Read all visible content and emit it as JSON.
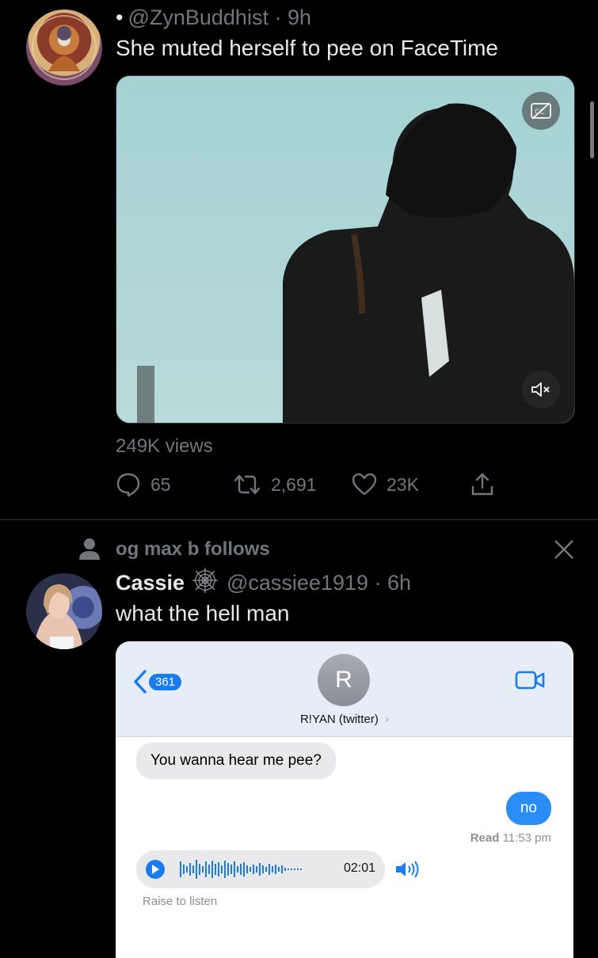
{
  "tweet1": {
    "bullet": "•",
    "handle_time": "@ZynBuddhist · 9h",
    "text": "She muted herself to pee on FaceTime",
    "views": "249K views",
    "replies": "65",
    "retweets": "2,691",
    "likes": "23K"
  },
  "tweet2": {
    "social_context": "og max b follows",
    "name": "Cassie",
    "handle_time": "@cassiee1919 · 6h",
    "text": "what the hell man",
    "imessage": {
      "back_count": "361",
      "contact_initial": "R",
      "contact_name": "R!YAN (twitter)",
      "incoming_message": "You wanna hear me pee?",
      "outgoing_message": "no",
      "read_status": "Read",
      "read_time": "11:53 pm",
      "audio_duration": "02:01",
      "raise_to_listen": "Raise to listen"
    }
  },
  "colors": {
    "background": "#000000",
    "text_primary": "#e7e9ea",
    "text_secondary": "#71767b",
    "imessage_blue": "#2a8cf5",
    "imessage_gray": "#e9e9eb"
  }
}
